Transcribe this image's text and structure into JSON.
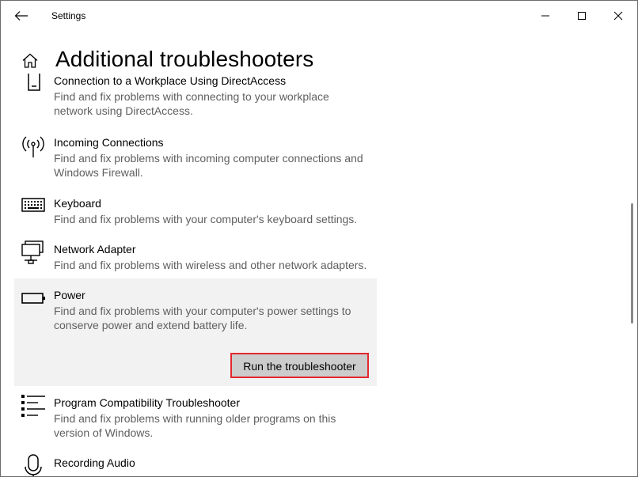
{
  "window": {
    "title": "Settings"
  },
  "page": {
    "title": "Additional troubleshooters"
  },
  "items": [
    {
      "name": "Connection to a Workplace Using DirectAccess",
      "desc_line1": "Find and fix problems with connecting to your workplace",
      "desc_line2": "network using DirectAccess.",
      "icon": "phone-icon"
    },
    {
      "name": "Incoming Connections",
      "desc_line1": "Find and fix problems with incoming computer connections and",
      "desc_line2": "Windows Firewall.",
      "icon": "antenna-icon"
    },
    {
      "name": "Keyboard",
      "desc_line1": "Find and fix problems with your computer's keyboard settings.",
      "icon": "keyboard-icon"
    },
    {
      "name": "Network Adapter",
      "desc_line1": "Find and fix problems with wireless and other network adapters.",
      "icon": "network-adapter-icon"
    },
    {
      "name": "Power",
      "desc_line1": "Find and fix problems with your computer's power settings to",
      "desc_line2": "conserve power and extend battery life.",
      "icon": "battery-icon",
      "button": "Run the troubleshooter",
      "selected": true
    },
    {
      "name": "Program Compatibility Troubleshooter",
      "desc_line1": "Find and fix problems with running older programs on this",
      "desc_line2": "version of Windows.",
      "icon": "list-icon"
    },
    {
      "name": "Recording Audio",
      "icon": "microphone-icon"
    }
  ],
  "colors": {
    "highlight_border": "#e3272e",
    "selected_bg": "#f2f2f2",
    "button_bg": "#cccccc"
  }
}
